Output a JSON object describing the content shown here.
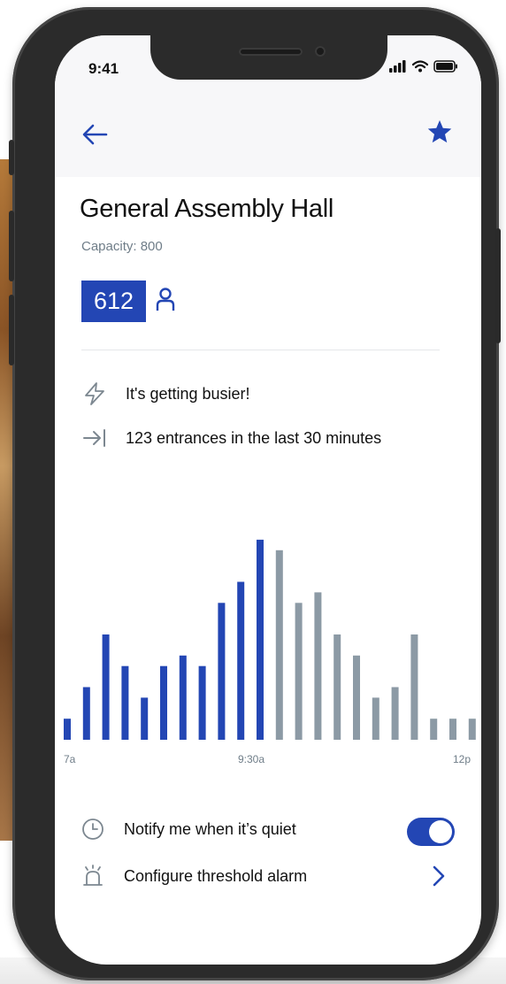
{
  "status_bar": {
    "time": "9:41"
  },
  "nav": {
    "back_icon": "arrow-left-icon",
    "favorite_icon": "star-icon"
  },
  "venue": {
    "name": "General Assembly Hall",
    "capacity_label": "Capacity: 800",
    "current_count": "612",
    "count_icon": "person-icon"
  },
  "insights": [
    {
      "icon": "lightning-icon",
      "text": "It's getting busier!"
    },
    {
      "icon": "arrow-right-to-bar-icon",
      "text": "123 entrances in the last 30 minutes"
    }
  ],
  "chart_data": {
    "type": "bar",
    "x_tick_labels": [
      "7a",
      "9:30a",
      "12p"
    ],
    "values": [
      2,
      5,
      10,
      7,
      4,
      7,
      8,
      7,
      13,
      15,
      19,
      18,
      13,
      14,
      10,
      8,
      4,
      5,
      10,
      2,
      2,
      2
    ],
    "highlighted_count": 11,
    "colors": {
      "past": "#2346b4",
      "future": "#8c9aa5"
    },
    "grid": false
  },
  "settings": {
    "notify": {
      "icon": "clock-icon",
      "label": "Notify me when it’s quiet",
      "enabled": true
    },
    "alarm": {
      "icon": "alarm-bell-icon",
      "label": "Configure threshold alarm",
      "action_icon": "chevron-right-icon"
    }
  },
  "colors": {
    "accent": "#2346b4",
    "muted_text": "#6f7d88",
    "future_bar": "#8c9aa5"
  }
}
